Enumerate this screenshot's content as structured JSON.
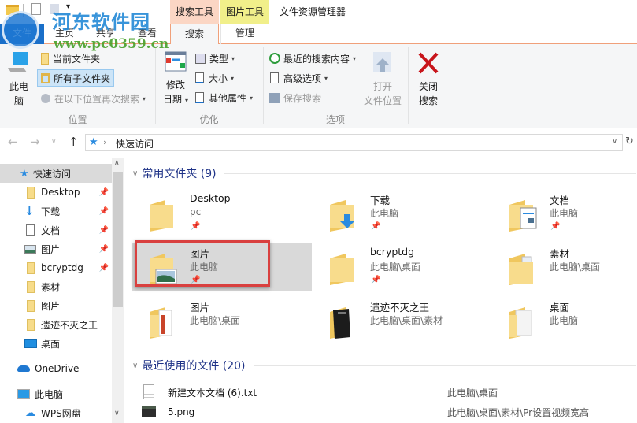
{
  "window": {
    "title": "文件资源管理器"
  },
  "context_tabs": [
    {
      "label": "搜索工具",
      "color": "#fbd6c4"
    },
    {
      "label": "图片工具",
      "color": "#f1ef8a"
    }
  ],
  "tabs": [
    {
      "label": "文件"
    },
    {
      "label": "主页"
    },
    {
      "label": "共享"
    },
    {
      "label": "查看"
    },
    {
      "label": "搜索",
      "active": true
    },
    {
      "label": "管理"
    }
  ],
  "watermark": {
    "title": "河东软件园",
    "url": "www.pc0359.cn"
  },
  "ribbon": {
    "groups": {
      "location": {
        "label": "位置",
        "this_pc": "此电\n脑",
        "this_pc_l1": "此电",
        "this_pc_l2": "脑",
        "current_folder": "当前文件夹",
        "all_subfolders": "所有子文件夹",
        "search_again": "在以下位置再次搜索"
      },
      "refine": {
        "label": "优化",
        "date_modified_l1": "修改",
        "date_modified_l2": "日期",
        "kind": "类型",
        "size": "大小",
        "other_props": "其他属性"
      },
      "options": {
        "label": "选项",
        "recent_searches": "最近的搜索内容",
        "advanced": "高级选项",
        "save_search": "保存搜索",
        "open_location_l1": "打开",
        "open_location_l2": "文件位置"
      },
      "close": {
        "close_l1": "关闭",
        "close_l2": "搜索"
      }
    }
  },
  "address": {
    "path": "快速访问",
    "separator": "›"
  },
  "nav_pane": {
    "items": [
      {
        "label": "快速访问",
        "icon": "star-icon",
        "selected": true,
        "pinned": false,
        "indent": 1
      },
      {
        "label": "Desktop",
        "icon": "folder-icon",
        "pinned": true,
        "indent": 2
      },
      {
        "label": "下载",
        "icon": "download-icon",
        "pinned": true,
        "indent": 2
      },
      {
        "label": "文档",
        "icon": "document-icon",
        "pinned": true,
        "indent": 2
      },
      {
        "label": "图片",
        "icon": "picture-icon",
        "pinned": true,
        "indent": 2
      },
      {
        "label": "bcryptdg",
        "icon": "folder-icon",
        "pinned": true,
        "indent": 2
      },
      {
        "label": "素材",
        "icon": "folder-icon",
        "pinned": false,
        "indent": 2
      },
      {
        "label": "图片",
        "icon": "folder-icon",
        "pinned": false,
        "indent": 2
      },
      {
        "label": "遗迹不灭之王",
        "icon": "folder-icon",
        "pinned": false,
        "indent": 2
      },
      {
        "label": "桌面",
        "icon": "desktop-icon",
        "pinned": false,
        "indent": 2
      },
      {
        "label": "OneDrive",
        "icon": "onedrive-icon",
        "pinned": false,
        "indent": 1
      },
      {
        "label": "此电脑",
        "icon": "computer-icon",
        "pinned": false,
        "indent": 1
      },
      {
        "label": "WPS网盘",
        "icon": "cloud-icon",
        "pinned": false,
        "indent": 2
      }
    ]
  },
  "frequent": {
    "heading": "常用文件夹 (9)",
    "items": [
      {
        "name": "Desktop",
        "path": "pc",
        "pinned": true,
        "icon": "folder-icon"
      },
      {
        "name": "下载",
        "path": "此电脑",
        "pinned": true,
        "icon": "download-folder-icon"
      },
      {
        "name": "文档",
        "path": "此电脑",
        "pinned": true,
        "icon": "documents-folder-icon"
      },
      {
        "name": "图片",
        "path": "此电脑",
        "pinned": true,
        "icon": "pictures-folder-icon",
        "selected": true
      },
      {
        "name": "bcryptdg",
        "path": "此电脑\\桌面",
        "pinned": true,
        "icon": "folder-icon"
      },
      {
        "name": "素材",
        "path": "此电脑\\桌面",
        "pinned": false,
        "icon": "folder-with-files-icon"
      },
      {
        "name": "图片",
        "path": "此电脑\\桌面",
        "pinned": false,
        "icon": "folder-with-images-icon"
      },
      {
        "name": "遗迹不灭之王",
        "path": "此电脑\\桌面\\素材",
        "pinned": false,
        "icon": "dark-folder-icon"
      },
      {
        "name": "桌面",
        "path": "此电脑",
        "pinned": false,
        "icon": "folder-with-files-icon"
      }
    ]
  },
  "recent": {
    "heading": "最近使用的文件 (20)",
    "items": [
      {
        "name": "新建文本文档 (6).txt",
        "path": "此电脑\\桌面",
        "icon": "text-file-icon"
      },
      {
        "name": "5.png",
        "path": "此电脑\\桌面\\素材\\Pr设置视频宽高",
        "icon": "image-file-icon"
      }
    ]
  },
  "scrollbar": {
    "nav_scroll_fraction": 0.0,
    "nav_visible_fraction": 0.57
  },
  "colors": {
    "accent": "#1a6fc9",
    "search_tab_border": "#f0a07a",
    "section_heading": "#1e3287",
    "highlight": "#d9403f"
  }
}
